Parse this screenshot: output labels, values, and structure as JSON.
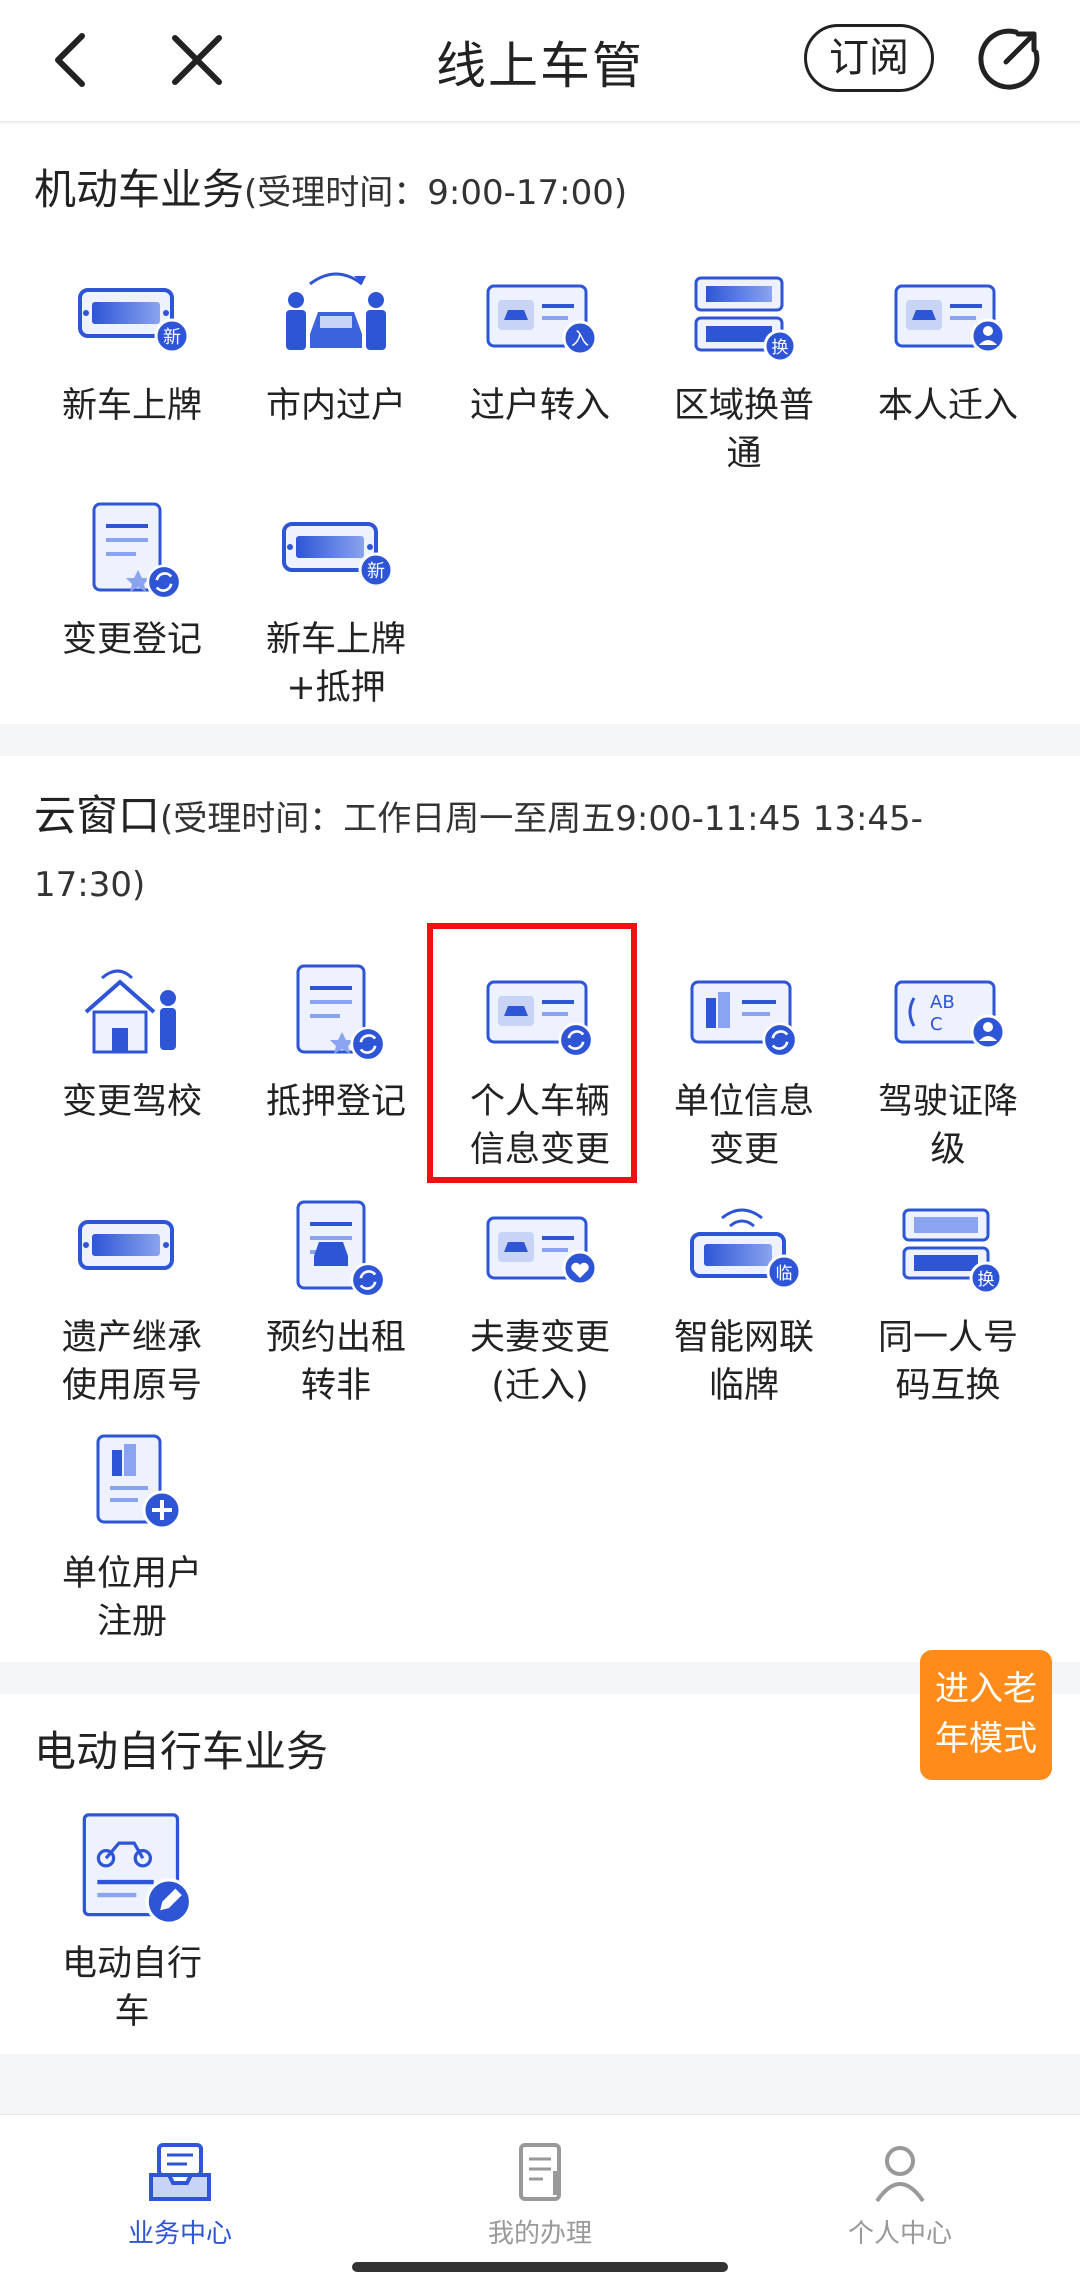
{
  "header": {
    "title": "线上车管",
    "subscribe_label": "订阅"
  },
  "sections": [
    {
      "title": "机动车业务",
      "hours": "(受理时间：9:00-17:00)",
      "items": [
        {
          "label": "新车上牌",
          "icon": "new-plate-icon"
        },
        {
          "label": "市内过户",
          "icon": "transfer-people-icon"
        },
        {
          "label": "过户转入",
          "icon": "transfer-in-icon"
        },
        {
          "label": "区域换普通",
          "icon": "plate-swap-icon"
        },
        {
          "label": "本人迁入",
          "icon": "self-move-in-icon"
        },
        {
          "label": "变更登记",
          "icon": "change-registration-icon"
        },
        {
          "label": "新车上牌\n+抵押",
          "icon": "new-plate-mortgage-icon"
        }
      ]
    },
    {
      "title": "云窗口",
      "hours_line1": "(受理时间：工作日周一至周五9:00-11:45 13:45-",
      "hours_line2": "17:30)",
      "items": [
        {
          "label": "变更驾校",
          "icon": "driving-school-icon"
        },
        {
          "label": "抵押登记",
          "icon": "mortgage-registration-icon"
        },
        {
          "label": "个人车辆\n信息变更",
          "icon": "personal-vehicle-info-icon"
        },
        {
          "label": "单位信息\n变更",
          "icon": "company-info-icon"
        },
        {
          "label": "驾驶证降\n级",
          "icon": "license-downgrade-icon"
        },
        {
          "label": "遗产继承\n使用原号",
          "icon": "inheritance-plate-icon"
        },
        {
          "label": "预约出租\n转非",
          "icon": "taxi-convert-icon"
        },
        {
          "label": "夫妻变更\n(迁入)",
          "icon": "spouse-change-icon"
        },
        {
          "label": "智能网联\n临牌",
          "icon": "smart-temp-plate-icon"
        },
        {
          "label": "同一人号\n码互换",
          "icon": "number-swap-icon"
        },
        {
          "label": "单位用户\n注册",
          "icon": "company-register-icon"
        }
      ]
    },
    {
      "title": "电动自行车业务",
      "items": [
        {
          "label": "电动自行\n车",
          "icon": "e-bike-icon"
        }
      ]
    }
  ],
  "elder_mode": "进入老\n年模式",
  "tabs": [
    {
      "label": "业务中心",
      "active": true,
      "icon": "inbox-icon"
    },
    {
      "label": "我的办理",
      "active": false,
      "icon": "document-icon"
    },
    {
      "label": "个人中心",
      "active": false,
      "icon": "user-icon"
    }
  ],
  "colors": {
    "accent": "#2d55d6",
    "orange": "#ff8c1a",
    "highlight": "#e11111",
    "inactive": "#999999"
  }
}
